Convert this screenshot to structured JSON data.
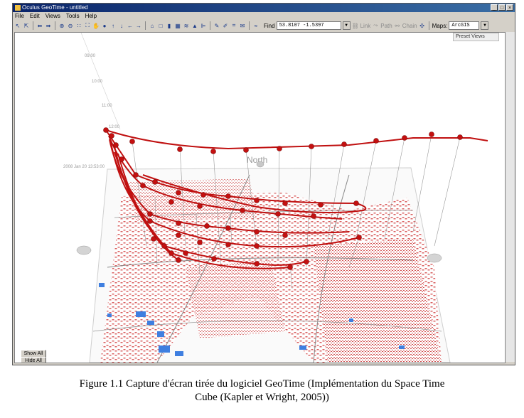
{
  "window": {
    "title": "Oculus GeoTime - untitled",
    "controls": [
      "_",
      "□",
      "×"
    ]
  },
  "menu": [
    "File",
    "Edit",
    "Views",
    "Tools",
    "Help"
  ],
  "toolbar": {
    "find_label": "Find",
    "coordinates": "53.8107 -1.5397",
    "link_label": "Link",
    "path_label": "Path",
    "chain_label": "Chain",
    "maps_label": "Maps:",
    "maps_value": "ArcGIS"
  },
  "viewport": {
    "preset_views_label": "Preset Views",
    "north_label": "North",
    "date_label": "2008 Jan 20 13:53:00",
    "time_ticks": [
      "09:00",
      "10:00",
      "11:00",
      "12:00"
    ],
    "show_all_label": "Show All",
    "hide_all_label": "Hide All"
  },
  "caption": {
    "line1": "Figure 1.1 Capture d'écran tirée du logiciel GeoTime (Implémentation du Space Time",
    "line2": "Cube (Kapler et Wright, 2005))"
  },
  "colors": {
    "track": "#c01010",
    "map_buildings": "#d65050",
    "water": "#3f7fe0",
    "titlebar": "#0a246a"
  }
}
